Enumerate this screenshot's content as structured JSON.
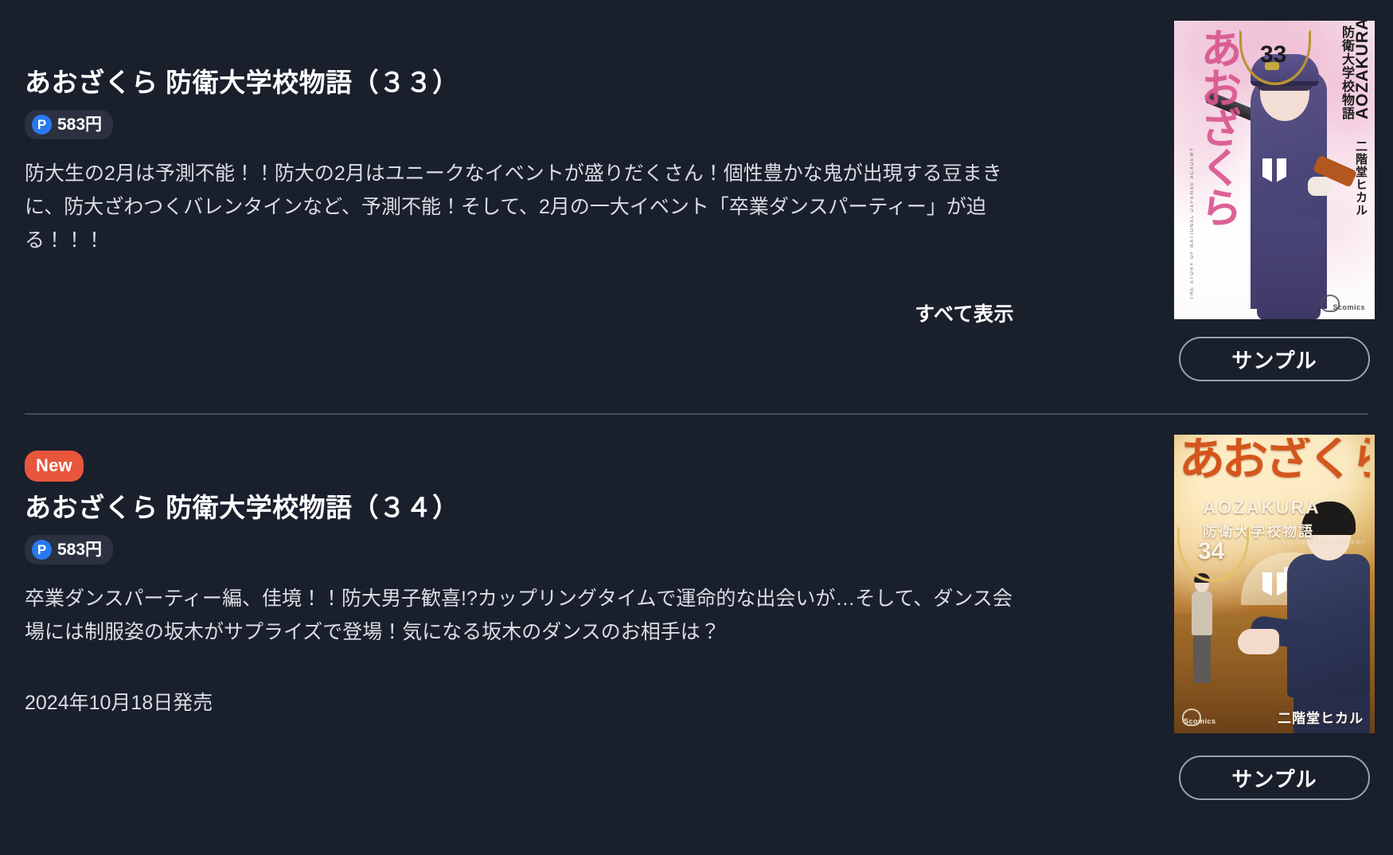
{
  "theme": {
    "background": "#1a1f2c",
    "text_primary": "#ffffff",
    "text_secondary": "#d9dde4",
    "divider": "#444c5b",
    "new_badge_bg": "#e8563c",
    "point_circle_bg": "#2979f2",
    "price_pill_bg": "#2b3140",
    "button_border": "#9aa2b1"
  },
  "items": [
    {
      "title": "あおざくら 防衛大学校物語（３３）",
      "point_icon": "P",
      "price": "583円",
      "description": "防大生の2月は予測不能！！防大の2月はユニークなイベントが盛りだくさん！個性豊かな鬼が出現する豆まきに、防大ざわつくバレンタインなど、予測不能！そして、2月の一大イベント「卒業ダンスパーティー」が迫る！！！",
      "show_all_label": "すべて表示",
      "sample_label": "サンプル",
      "cover": {
        "brush_title": "あおざくら",
        "latin_title": "AOZAKURA",
        "jp_subtitle": "防衛大学校物語",
        "author": "二階堂ヒカル",
        "volume": "33",
        "tagline": "THE STORY OF NATIONAL DEFENSE ACADEMY",
        "imprint": "Scomics"
      }
    },
    {
      "new_label": "New",
      "title": "あおざくら 防衛大学校物語（３４）",
      "point_icon": "P",
      "price": "583円",
      "description": "卒業ダンスパーティー編、佳境！！防大男子歓喜!?カップリングタイムで運命的な出会いが…そして、ダンス会場には制服姿の坂木がサプライズで登場！気になる坂木のダンスのお相手は？",
      "release_date": "2024年10月18日発売",
      "sample_label": "サンプル",
      "cover": {
        "brush_title": "あおざくら",
        "latin_title": "AOZAKURA",
        "jp_subtitle": "防衛大学校物語",
        "author": "二階堂ヒカル",
        "volume": "34",
        "tagline": "THE STORY OF NATIONAL DEFENSE ACADEMY",
        "imprint": "Scomics"
      }
    }
  ]
}
